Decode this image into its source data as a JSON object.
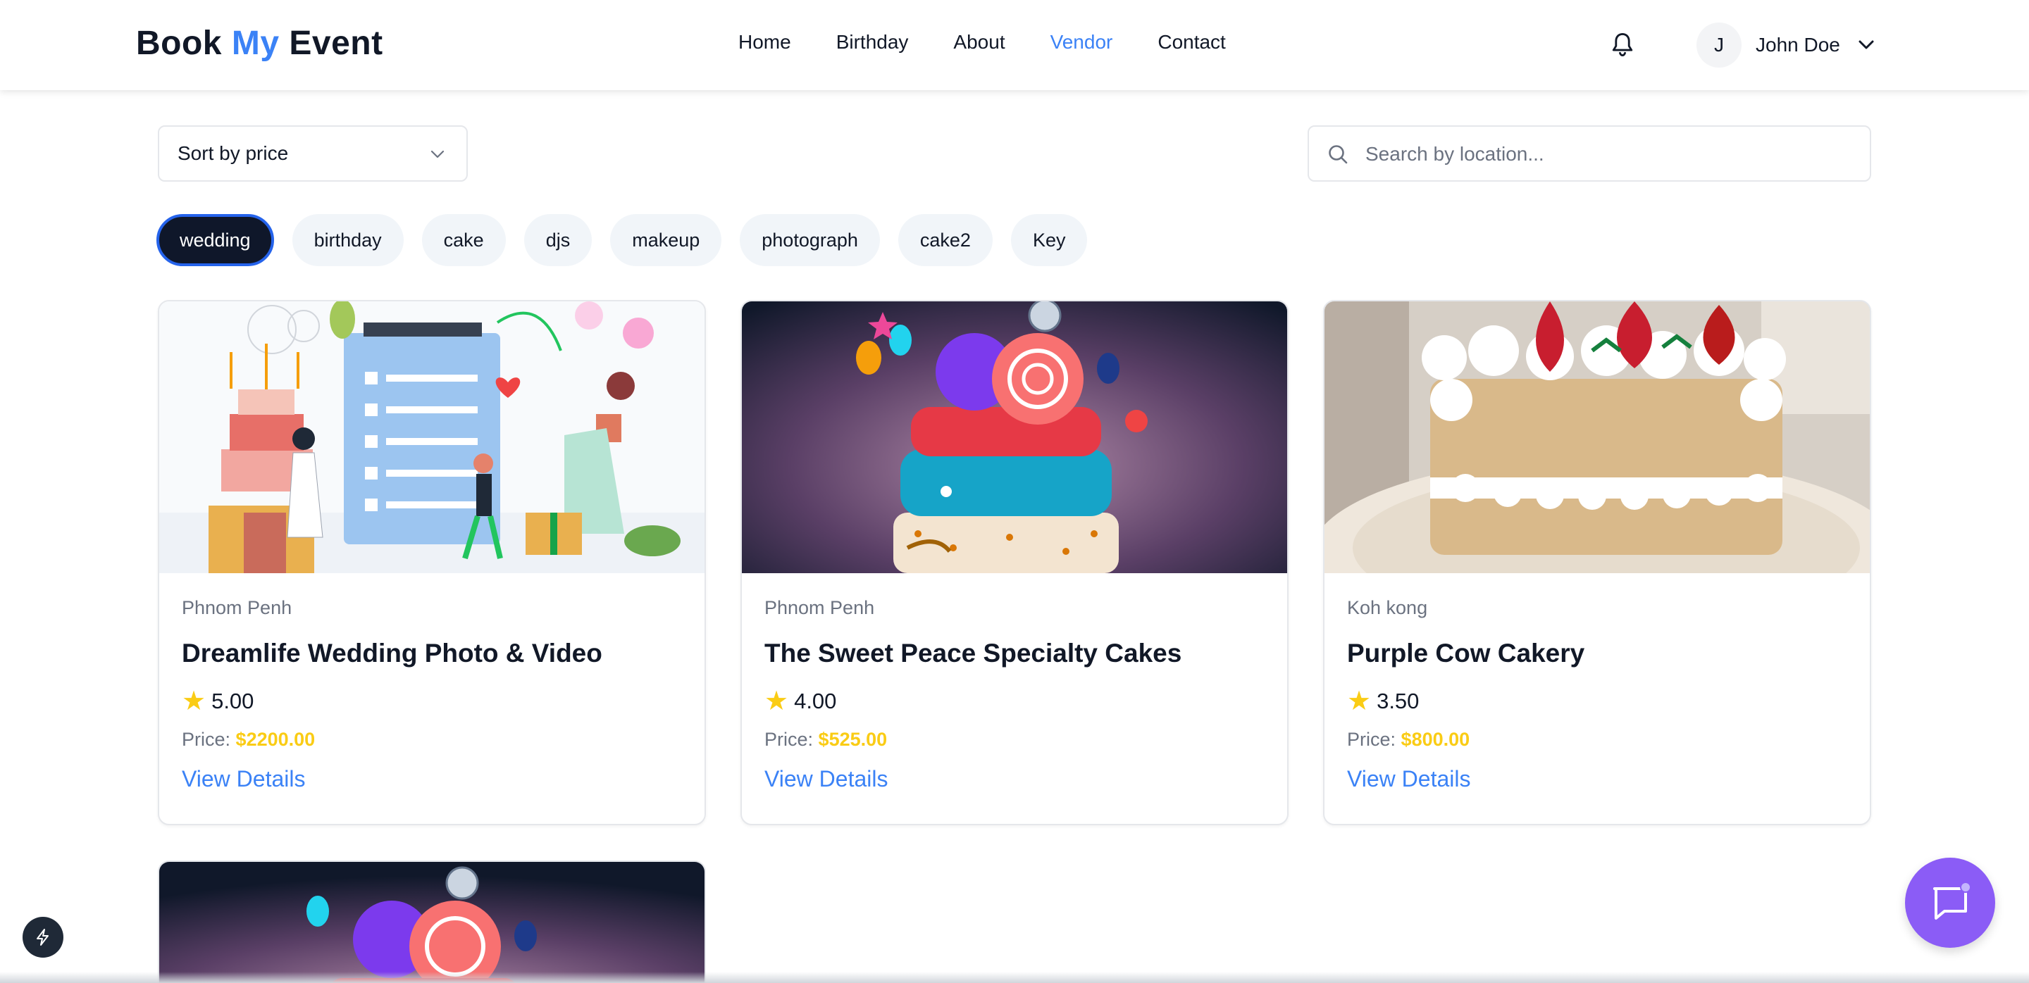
{
  "header": {
    "logo_book": "Book",
    "logo_my": "My",
    "logo_event": "Event",
    "nav": [
      "Home",
      "Birthday",
      "About",
      "Vendor",
      "Contact"
    ],
    "active_nav": "Vendor",
    "notification_icon": "bell-icon",
    "user": {
      "initial": "J",
      "name": "John Doe"
    }
  },
  "filters": {
    "sort_label": "Sort by price",
    "search_placeholder": "Search by location...",
    "categories": [
      "wedding",
      "birthday",
      "cake",
      "djs",
      "makeup",
      "photograph",
      "cake2",
      "Key"
    ],
    "active_category": "wedding"
  },
  "vendors": [
    {
      "location": "Phnom Penh",
      "name": "Dreamlife Wedding Photo & Video",
      "rating": "5.00",
      "price_label": "Price:",
      "price": "$2200.00",
      "link": "View Details"
    },
    {
      "location": "Phnom Penh",
      "name": "The Sweet Peace Specialty Cakes",
      "rating": "4.00",
      "price_label": "Price:",
      "price": "$525.00",
      "link": "View Details"
    },
    {
      "location": "Koh kong",
      "name": "Purple Cow Cakery",
      "rating": "3.50",
      "price_label": "Price:",
      "price": "$800.00",
      "link": "View Details"
    }
  ],
  "colors": {
    "accent": "#3b82f6",
    "price": "#facc15",
    "chat": "#8b5cf6",
    "chip_active": "#0f172a"
  }
}
